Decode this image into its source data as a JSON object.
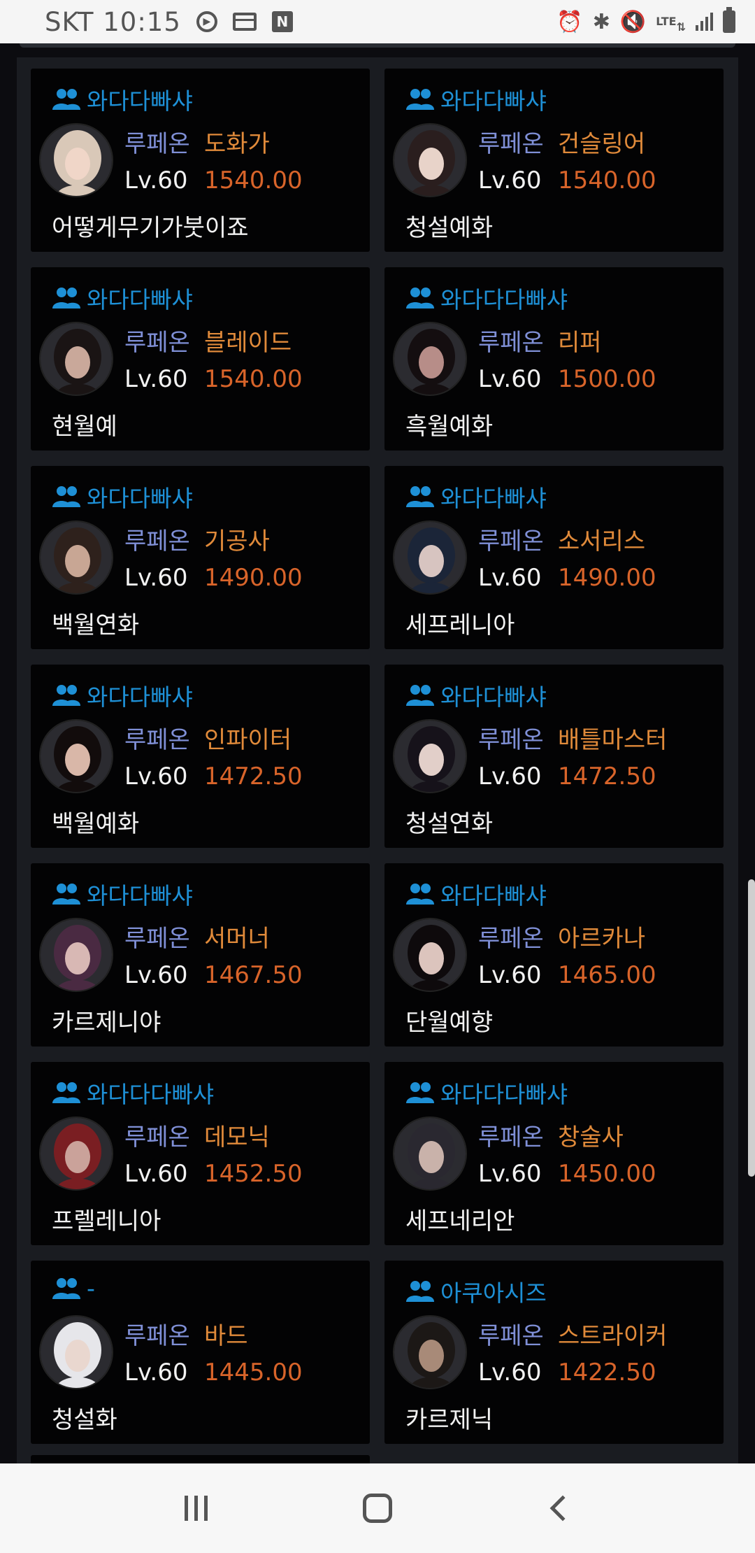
{
  "status_bar": {
    "carrier_time": "SKT 10:15",
    "left_icons": [
      "media-play-icon",
      "card-icon",
      "naver-n-icon"
    ],
    "naver_glyph": "N",
    "right_icons": [
      "alarm-icon",
      "bluetooth-icon",
      "mute-icon",
      "lte-icon",
      "signal-icon",
      "battery-icon"
    ],
    "lte_label": "LTE"
  },
  "characters": [
    {
      "guild": "와다다빠샤",
      "server": "루페온",
      "class": "도화가",
      "level": "Lv.60",
      "item_level": "1540.00",
      "name": "어떻게무기가붓이죠",
      "avatar_hair": "#d9c8b8",
      "avatar_skin": "#f0d6c8"
    },
    {
      "guild": "와다다빠샤",
      "server": "루페온",
      "class": "건슬링어",
      "level": "Lv.60",
      "item_level": "1540.00",
      "name": "청설예화",
      "avatar_hair": "#2a1e1e",
      "avatar_skin": "#e8d3c9"
    },
    {
      "guild": "와다다빠샤",
      "server": "루페온",
      "class": "블레이드",
      "level": "Lv.60",
      "item_level": "1540.00",
      "name": "현월예",
      "avatar_hair": "#1a1414",
      "avatar_skin": "#c9a89a"
    },
    {
      "guild": "와다다다빠샤",
      "server": "루페온",
      "class": "리퍼",
      "level": "Lv.60",
      "item_level": "1500.00",
      "name": "흑월예화",
      "avatar_hair": "#140e10",
      "avatar_skin": "#b78d88"
    },
    {
      "guild": "와다다빠샤",
      "server": "루페온",
      "class": "기공사",
      "level": "Lv.60",
      "item_level": "1490.00",
      "name": "백월연화",
      "avatar_hair": "#2e211c",
      "avatar_skin": "#c8a694"
    },
    {
      "guild": "와다다빠샤",
      "server": "루페온",
      "class": "소서리스",
      "level": "Lv.60",
      "item_level": "1490.00",
      "name": "세프레니아",
      "avatar_hair": "#1b2538",
      "avatar_skin": "#d7c4c0"
    },
    {
      "guild": "와다다빠샤",
      "server": "루페온",
      "class": "인파이터",
      "level": "Lv.60",
      "item_level": "1472.50",
      "name": "백월예화",
      "avatar_hair": "#120c0c",
      "avatar_skin": "#d9b7a8"
    },
    {
      "guild": "와다다빠샤",
      "server": "루페온",
      "class": "배틀마스터",
      "level": "Lv.60",
      "item_level": "1472.50",
      "name": "청설연화",
      "avatar_hair": "#16121a",
      "avatar_skin": "#e2cfc9"
    },
    {
      "guild": "와다다빠샤",
      "server": "루페온",
      "class": "서머너",
      "level": "Lv.60",
      "item_level": "1467.50",
      "name": "카르제니야",
      "avatar_hair": "#4a2a42",
      "avatar_skin": "#d8b8b4"
    },
    {
      "guild": "와다다빠샤",
      "server": "루페온",
      "class": "아르카나",
      "level": "Lv.60",
      "item_level": "1465.00",
      "name": "단월예향",
      "avatar_hair": "#0e0a0c",
      "avatar_skin": "#dcc4bd"
    },
    {
      "guild": "와다다다빠샤",
      "server": "루페온",
      "class": "데모닉",
      "level": "Lv.60",
      "item_level": "1452.50",
      "name": "프렐레니아",
      "avatar_hair": "#7a1e22",
      "avatar_skin": "#caa29a"
    },
    {
      "guild": "와다다다빠샤",
      "server": "루페온",
      "class": "창술사",
      "level": "Lv.60",
      "item_level": "1450.00",
      "name": "세프네리안",
      "avatar_hair": "#2a2830",
      "avatar_skin": "#c9b2aa"
    },
    {
      "guild": "-",
      "server": "루페온",
      "class": "바드",
      "level": "Lv.60",
      "item_level": "1445.00",
      "name": "청설화",
      "avatar_hair": "#e6e6ea",
      "avatar_skin": "#e9d7cf"
    },
    {
      "guild": "아쿠아시즈",
      "server": "루페온",
      "class": "스트라이커",
      "level": "Lv.60",
      "item_level": "1422.50",
      "name": "카르제닉",
      "avatar_hair": "#1c1816",
      "avatar_skin": "#a88a78"
    }
  ],
  "colors": {
    "guild": "#1e90d6",
    "server": "#7f8fd6",
    "class": "#e08a3a",
    "item_level": "#d8642a",
    "card_bg": "#030304",
    "panel_bg": "#1a1c21"
  },
  "nav_bar": {
    "buttons": [
      "recent-apps",
      "home",
      "back"
    ]
  }
}
